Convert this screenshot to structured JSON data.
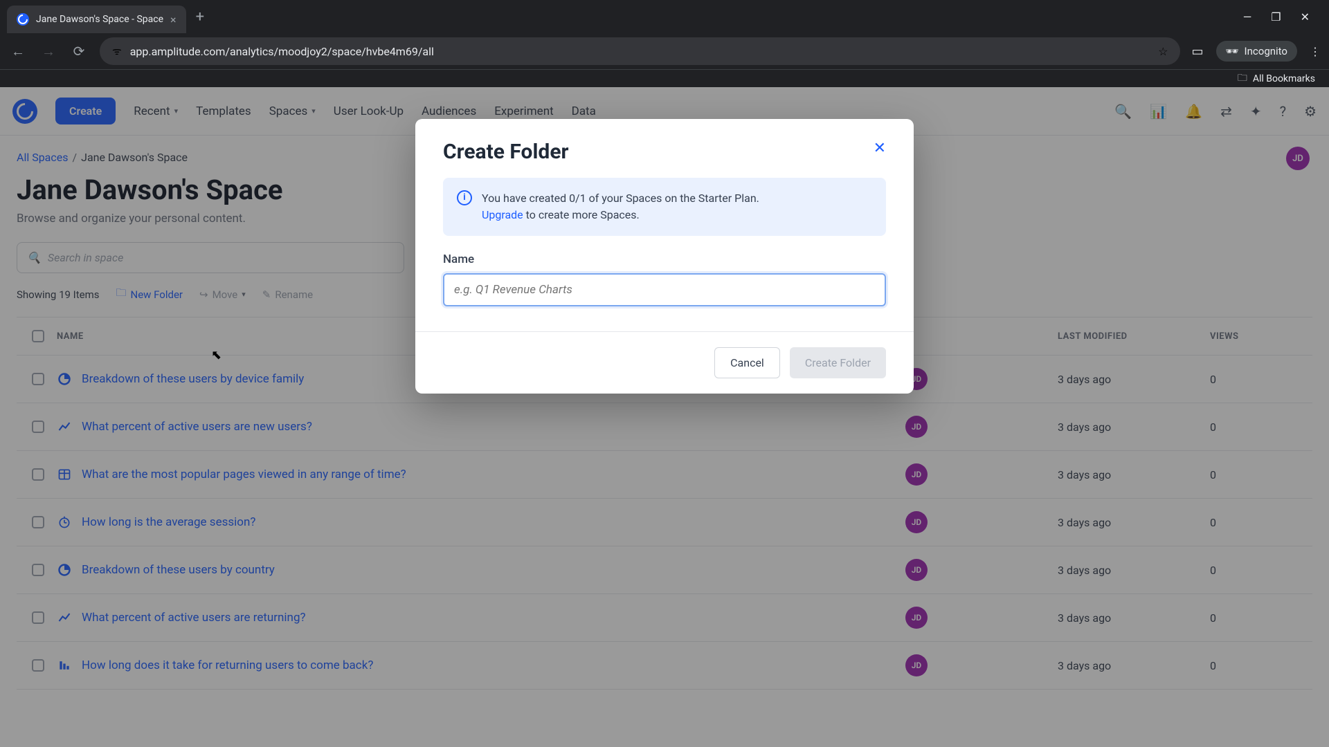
{
  "browser": {
    "tab_title": "Jane Dawson's Space - Space",
    "url": "app.amplitude.com/analytics/moodjoy2/space/hvbe4m69/all",
    "incognito_label": "Incognito",
    "bookmarks_label": "All Bookmarks"
  },
  "nav": {
    "create": "Create",
    "items": [
      "Recent",
      "Templates",
      "Spaces",
      "User Look-Up",
      "Audiences",
      "Experiment",
      "Data"
    ]
  },
  "breadcrumb": {
    "root": "All Spaces",
    "current": "Jane Dawson's Space"
  },
  "page": {
    "title": "Jane Dawson's Space",
    "subtitle": "Browse and organize your personal content.",
    "search_placeholder": "Search in space",
    "avatar_initials": "JD"
  },
  "toolbar": {
    "count_label": "Showing 19 Items",
    "new_folder": "New Folder",
    "move": "Move",
    "rename": "Rename"
  },
  "columns": {
    "name": "NAME",
    "owner": "",
    "modified": "LAST MODIFIED",
    "views": "VIEWS"
  },
  "rows": [
    {
      "icon": "segmentation",
      "name": "Breakdown of these users by device family",
      "owner": "JD",
      "modified": "3 days ago",
      "views": "0"
    },
    {
      "icon": "line",
      "name": "What percent of active users are new users?",
      "owner": "JD",
      "modified": "3 days ago",
      "views": "0"
    },
    {
      "icon": "table",
      "name": "What are the most popular pages viewed in any range of time?",
      "owner": "JD",
      "modified": "3 days ago",
      "views": "0"
    },
    {
      "icon": "clock",
      "name": "How long is the average session?",
      "owner": "JD",
      "modified": "3 days ago",
      "views": "0"
    },
    {
      "icon": "segmentation",
      "name": "Breakdown of these users by country",
      "owner": "JD",
      "modified": "3 days ago",
      "views": "0"
    },
    {
      "icon": "line",
      "name": "What percent of active users are returning?",
      "owner": "JD",
      "modified": "3 days ago",
      "views": "0"
    },
    {
      "icon": "funnel",
      "name": "How long does it take for returning users to come back?",
      "owner": "JD",
      "modified": "3 days ago",
      "views": "0"
    }
  ],
  "modal": {
    "title": "Create Folder",
    "info_line1": "You have created 0/1 of your Spaces on the Starter Plan.",
    "info_upgrade": "Upgrade",
    "info_line2": " to create more Spaces.",
    "name_label": "Name",
    "name_placeholder": "e.g. Q1 Revenue Charts",
    "cancel": "Cancel",
    "submit": "Create Folder"
  }
}
